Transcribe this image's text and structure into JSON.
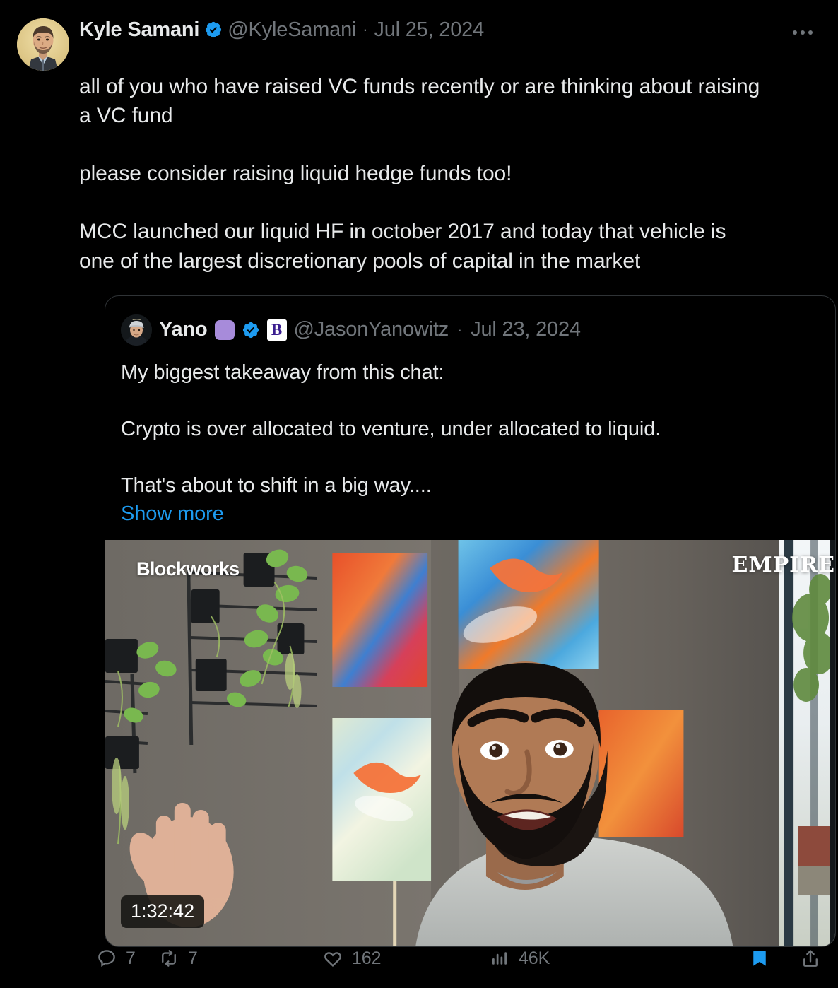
{
  "theme": {
    "background": "#000000",
    "text": "#e7e9ea",
    "muted": "#71767b",
    "link": "#1d9bf0",
    "verified_blue": "#1d9bf0",
    "border": "#2f3336",
    "bookmark_active": "#1d9bf0"
  },
  "tweet": {
    "author": {
      "display_name": "Kyle Samani",
      "handle": "@KyleSamani",
      "verified": true,
      "avatar_alt": "avatar-kyle-samani"
    },
    "separator": "·",
    "date": "Jul 25, 2024",
    "more_menu": "···",
    "text": "all of you who have raised VC funds recently or are thinking about raising a VC fund\n\nplease consider raising liquid hedge funds too!\n\nMCC launched our liquid HF in october 2017 and today that vehicle is one of the largest discretionary pools of capital in the market"
  },
  "quoted_tweet": {
    "author": {
      "display_name": "Yano",
      "handle": "@JasonYanowitz",
      "verified": true,
      "emoji_badge": "purple-square",
      "affiliate_badge": "B",
      "avatar_alt": "avatar-jason-yanowitz"
    },
    "separator": "·",
    "date": "Jul 23, 2024",
    "text": "My biggest takeaway from this chat:\n\nCrypto is over allocated to venture, under allocated to liquid.\n\nThat's about to shift in a big way....",
    "show_more_label": "Show more",
    "media": {
      "type": "video",
      "duration": "1:32:42",
      "brand_left": "Blockworks",
      "brand_right": "EMPIRE"
    }
  },
  "actions": {
    "reply": {
      "icon": "reply-icon",
      "count": "7"
    },
    "retweet": {
      "icon": "retweet-icon",
      "count": "7"
    },
    "like": {
      "icon": "heart-icon",
      "count": "162"
    },
    "views": {
      "icon": "analytics-icon",
      "count": "46K"
    },
    "bookmark": {
      "icon": "bookmark-icon",
      "active": true
    },
    "share": {
      "icon": "share-icon"
    }
  }
}
